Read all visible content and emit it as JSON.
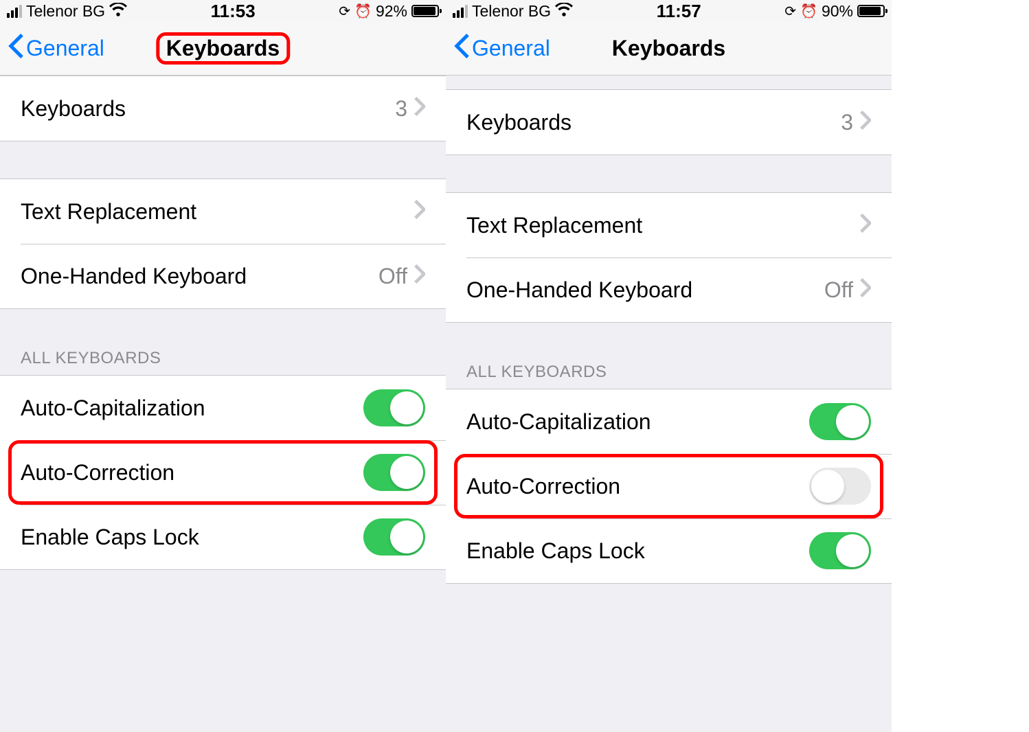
{
  "screens": [
    {
      "status": {
        "carrier": "Telenor BG",
        "time": "11:53",
        "battery_pct": "92%",
        "battery_fill": 92
      },
      "nav": {
        "back_label": "General",
        "title": "Keyboards",
        "title_highlighted": true
      },
      "section_keyboards": {
        "label": "Keyboards",
        "count": "3"
      },
      "section_text": {
        "text_replacement": "Text Replacement",
        "one_handed_label": "One-Handed Keyboard",
        "one_handed_value": "Off"
      },
      "all_keyboards_header": "ALL KEYBOARDS",
      "toggles": {
        "auto_cap": {
          "label": "Auto-Capitalization",
          "on": true
        },
        "auto_correct": {
          "label": "Auto-Correction",
          "on": true,
          "highlighted": true
        },
        "caps_lock": {
          "label": "Enable Caps Lock",
          "on": true
        }
      }
    },
    {
      "status": {
        "carrier": "Telenor BG",
        "time": "11:57",
        "battery_pct": "90%",
        "battery_fill": 90
      },
      "nav": {
        "back_label": "General",
        "title": "Keyboards",
        "title_highlighted": false
      },
      "section_keyboards": {
        "label": "Keyboards",
        "count": "3"
      },
      "section_text": {
        "text_replacement": "Text Replacement",
        "one_handed_label": "One-Handed Keyboard",
        "one_handed_value": "Off"
      },
      "all_keyboards_header": "ALL KEYBOARDS",
      "toggles": {
        "auto_cap": {
          "label": "Auto-Capitalization",
          "on": true
        },
        "auto_correct": {
          "label": "Auto-Correction",
          "on": false,
          "highlighted": true
        },
        "caps_lock": {
          "label": "Enable Caps Lock",
          "on": true
        }
      }
    }
  ]
}
